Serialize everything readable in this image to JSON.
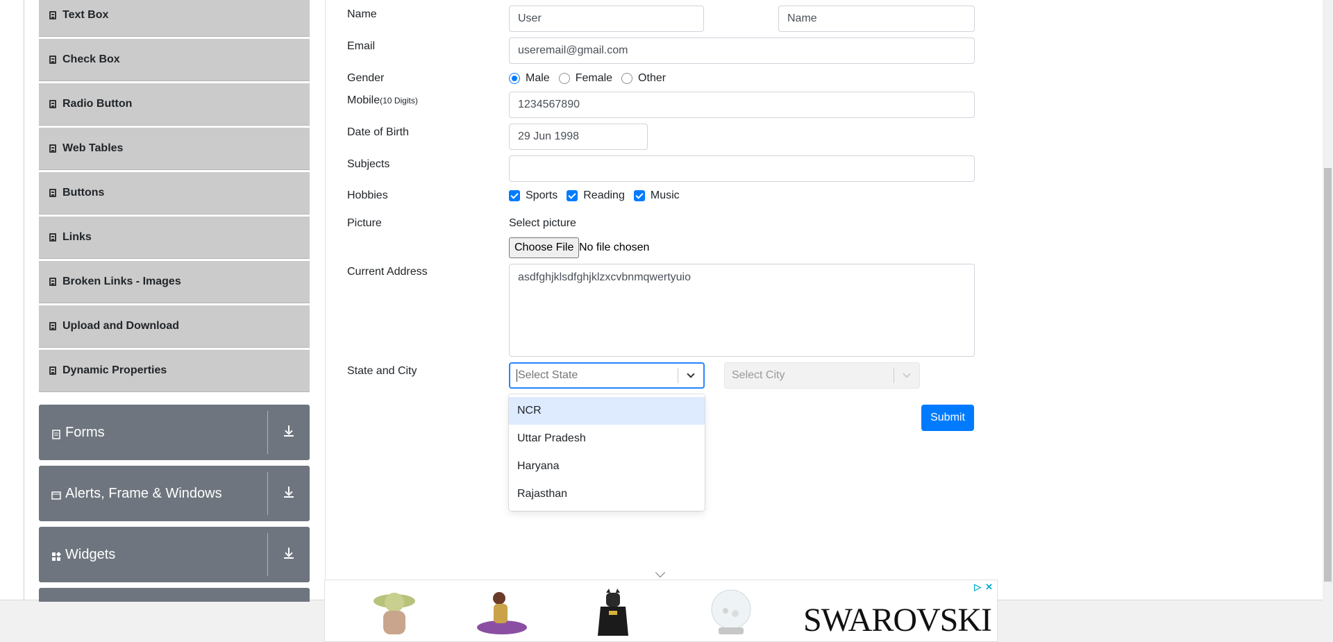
{
  "sidebar": {
    "elements_items": [
      {
        "label": "Text Box"
      },
      {
        "label": "Check Box"
      },
      {
        "label": "Radio Button"
      },
      {
        "label": "Web Tables"
      },
      {
        "label": "Buttons"
      },
      {
        "label": "Links"
      },
      {
        "label": "Broken Links - Images"
      },
      {
        "label": "Upload and Download"
      },
      {
        "label": "Dynamic Properties"
      }
    ],
    "groups": [
      {
        "label": "Forms",
        "icon": "form-icon"
      },
      {
        "label": "Alerts, Frame & Windows",
        "icon": "window-icon"
      },
      {
        "label": "Widgets",
        "icon": "widgets-icon"
      }
    ]
  },
  "form": {
    "name_label": "Name",
    "first_name_value": "User",
    "last_name_value": "Name",
    "email_label": "Email",
    "email_value": "useremail@gmail.com",
    "gender_label": "Gender",
    "gender_options": [
      "Male",
      "Female",
      "Other"
    ],
    "gender_selected": "Male",
    "mobile_label": "Mobile",
    "mobile_hint": "(10 Digits)",
    "mobile_value": "1234567890",
    "dob_label": "Date of Birth",
    "dob_value": "29 Jun 1998",
    "subjects_label": "Subjects",
    "subjects_value": "",
    "hobbies_label": "Hobbies",
    "hobbies": [
      "Sports",
      "Reading",
      "Music"
    ],
    "picture_label": "Picture",
    "select_picture_label": "Select picture",
    "choose_file_label": "Choose File",
    "file_status": "No file chosen",
    "address_label": "Current Address",
    "address_value": "asdfghjklsdfghjklzxcvbnmqwertyuio",
    "state_city_label": "State and City",
    "state_placeholder": "Select State",
    "city_placeholder": "Select City",
    "state_options": [
      "NCR",
      "Uttar Pradesh",
      "Haryana",
      "Rajasthan"
    ],
    "state_focused_option": "NCR",
    "submit_label": "Submit"
  },
  "ad": {
    "brand": "SWAROVSKI",
    "accent_color": "#00aecd"
  },
  "colors": {
    "primary": "#007bff",
    "sidebar_item_bg": "#cbcbcb",
    "group_bg": "#6e757e",
    "focus_option_bg": "#deebff"
  }
}
